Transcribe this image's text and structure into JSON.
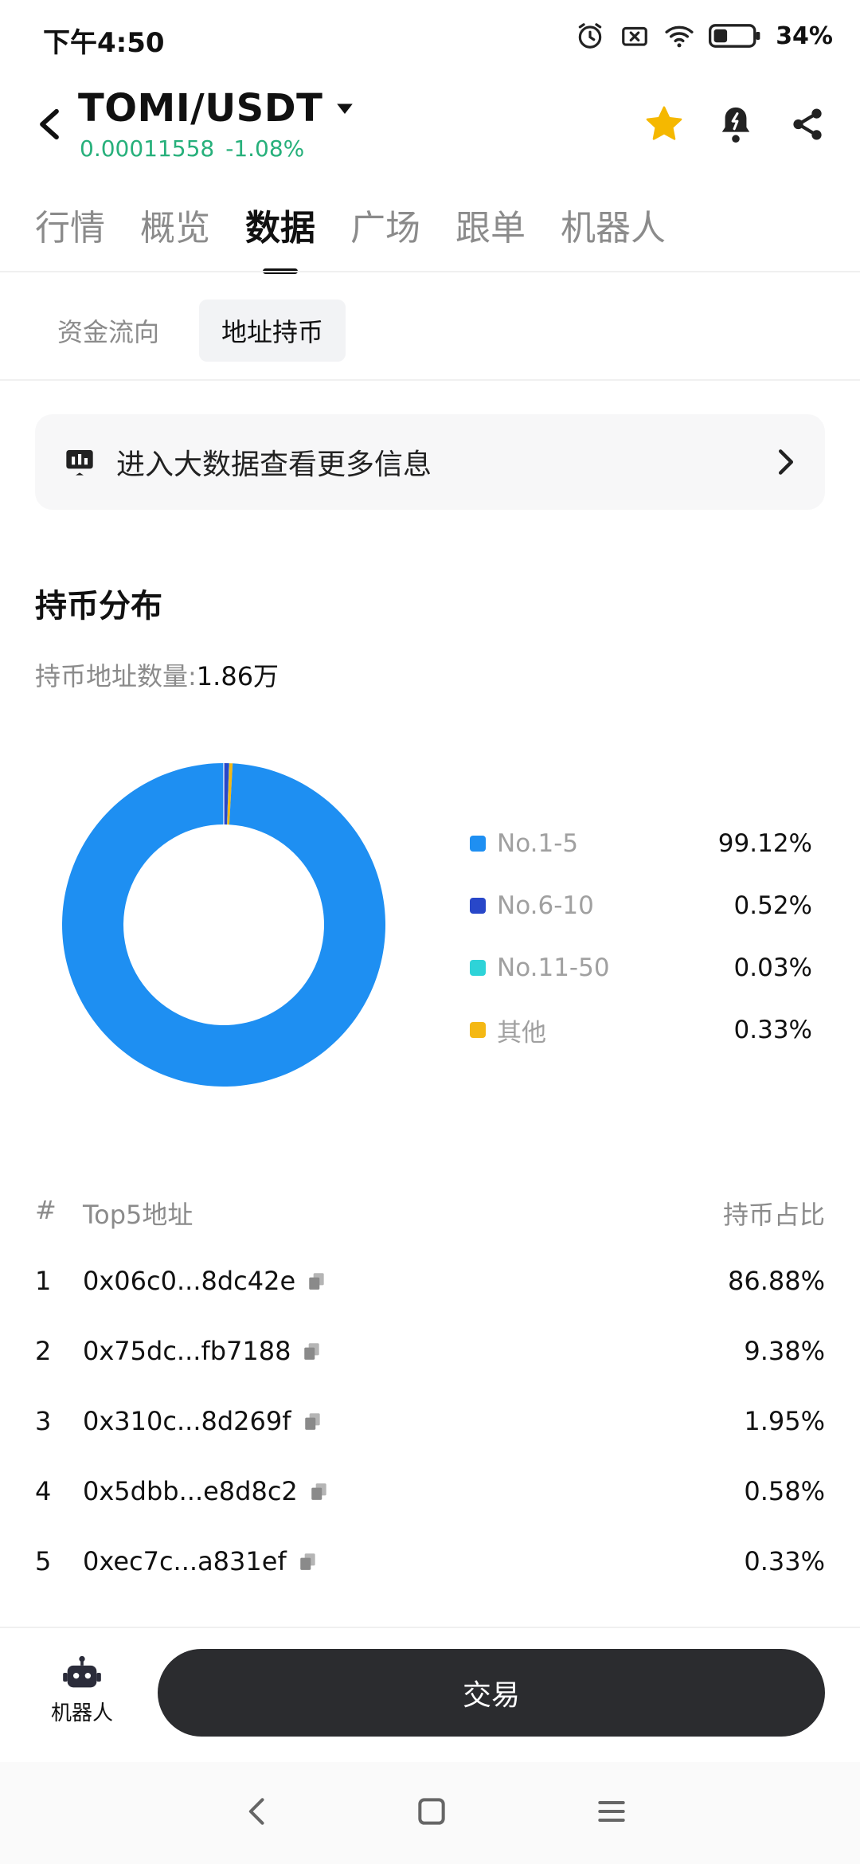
{
  "status": {
    "time": "下午4:50",
    "battery": "34%"
  },
  "header": {
    "pair": "TOMI/USDT",
    "price": "0.00011558",
    "change": "-1.08%"
  },
  "tabs": [
    {
      "label": "行情"
    },
    {
      "label": "概览"
    },
    {
      "label": "数据"
    },
    {
      "label": "广场"
    },
    {
      "label": "跟单"
    },
    {
      "label": "机器人"
    }
  ],
  "subtabs": [
    {
      "label": "资金流向"
    },
    {
      "label": "地址持币"
    }
  ],
  "banner": {
    "text": "进入大数据查看更多信息"
  },
  "holdings": {
    "title": "持币分布",
    "count_label": "持币地址数量:",
    "count_value": "1.86万"
  },
  "chart_data": {
    "type": "pie",
    "categories": [
      "No.1-5",
      "No.6-10",
      "No.11-50",
      "其他"
    ],
    "values": [
      99.12,
      0.52,
      0.03,
      0.33
    ],
    "value_labels": [
      "99.12%",
      "0.52%",
      "0.03%",
      "0.33%"
    ],
    "colors": [
      "#1e8ff2",
      "#2847c9",
      "#2ed3d8",
      "#f4b814"
    ],
    "donut": true,
    "legend": "right"
  },
  "top5": {
    "header_rank": "#",
    "header_addr": "Top5地址",
    "header_pct": "持币占比",
    "rows": [
      {
        "rank": "1",
        "address": "0x06c0...8dc42e",
        "pct": "86.88%"
      },
      {
        "rank": "2",
        "address": "0x75dc...fb7188",
        "pct": "9.38%"
      },
      {
        "rank": "3",
        "address": "0x310c...8d269f",
        "pct": "1.95%"
      },
      {
        "rank": "4",
        "address": "0x5dbb...e8d8c2",
        "pct": "0.58%"
      },
      {
        "rank": "5",
        "address": "0xec7c...a831ef",
        "pct": "0.33%"
      }
    ]
  },
  "bottom": {
    "robot_label": "机器人",
    "trade_label": "交易"
  },
  "colors": {
    "accent_green": "#27b07b",
    "star": "#f5b800",
    "button_dark": "#2b2c2f"
  }
}
